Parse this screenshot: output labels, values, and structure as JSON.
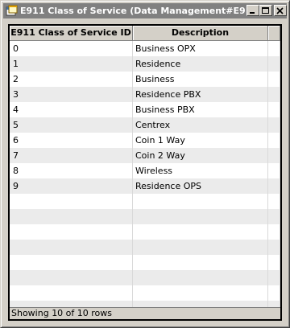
{
  "window": {
    "title": "E911 Class of Service (Data Management#E911..."
  },
  "table": {
    "columns": [
      "E911 Class of Service ID",
      "Description"
    ],
    "rows": [
      {
        "id": "0",
        "description": "Business OPX"
      },
      {
        "id": "1",
        "description": "Residence"
      },
      {
        "id": "2",
        "description": "Business"
      },
      {
        "id": "3",
        "description": "Residence PBX"
      },
      {
        "id": "4",
        "description": "Business PBX"
      },
      {
        "id": "5",
        "description": "Centrex"
      },
      {
        "id": "6",
        "description": "Coin 1 Way"
      },
      {
        "id": "7",
        "description": "Coin 2 Way"
      },
      {
        "id": "8",
        "description": "Wireless"
      },
      {
        "id": "9",
        "description": "Residence OPS"
      }
    ]
  },
  "status": {
    "text": "Showing 10 of 10 rows"
  },
  "colors": {
    "titlebar_inactive": "#808080",
    "window_face": "#d4d0c8",
    "alt_row": "#ebebeb"
  }
}
